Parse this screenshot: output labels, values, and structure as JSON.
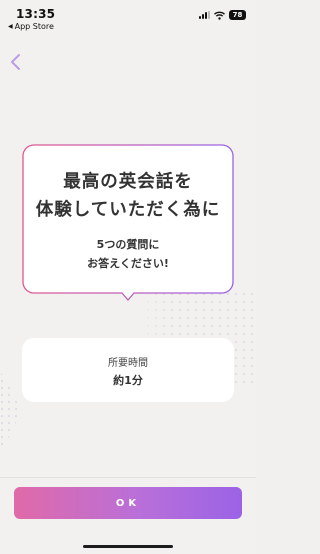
{
  "status_bar": {
    "time": "13:35",
    "back_app": "App Store",
    "battery": "78"
  },
  "card": {
    "headline_line1": "最高の英会話を",
    "headline_line2": "体験していただく為に",
    "sub_line1": "5つの質問に",
    "sub_line2": "お答えください!"
  },
  "time_card": {
    "label": "所要時間",
    "value": "約1分"
  },
  "ok_button": {
    "label": "OK"
  },
  "colors": {
    "background": "#f3f1ef",
    "accent_pink": "#e0588f",
    "accent_purple": "#9b63e6",
    "back_chevron": "#b89ee6",
    "dots": "#e3dde3"
  },
  "icons": {
    "back": "chevron-left-icon",
    "signal": "cellular-signal-icon",
    "wifi": "wifi-icon",
    "battery": "battery-icon"
  }
}
